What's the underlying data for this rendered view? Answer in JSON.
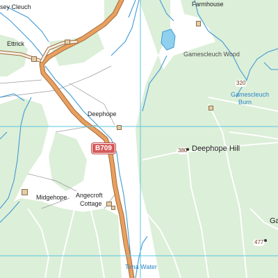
{
  "colors": {
    "land": "#ffffff",
    "forest": "#dcefd8",
    "water": "#3f9ad6",
    "road_fill": "#e8a060",
    "road_casing": "#a66a37",
    "grid": "#5cc6e0",
    "track": "#ffffff",
    "road_shield": "#d55a5a"
  },
  "labels": {
    "farmhouse": "Farmhouse",
    "sey_cleuch": "sey Cleuch",
    "ettrick": "Ettrick",
    "gamescleuch_wood": "Gamescleuch Wood",
    "gamescleuch_burn_1": "Gamescleuch",
    "gamescleuch_burn_2": "Burn",
    "deephope": "Deephope",
    "deephope_hill": "Deephope Hill",
    "midgehope": "Midgehope",
    "angecroft_1": "Angecroft",
    "angecroft_2": "Cottage",
    "tima_water": "Tima Water",
    "ga_partial": "Ga"
  },
  "spot_heights": {
    "h320": "320",
    "h380": "380",
    "h477": "477"
  },
  "road_ref": "B709",
  "icons": [
    "summit-dot-icon",
    "building-icon"
  ]
}
